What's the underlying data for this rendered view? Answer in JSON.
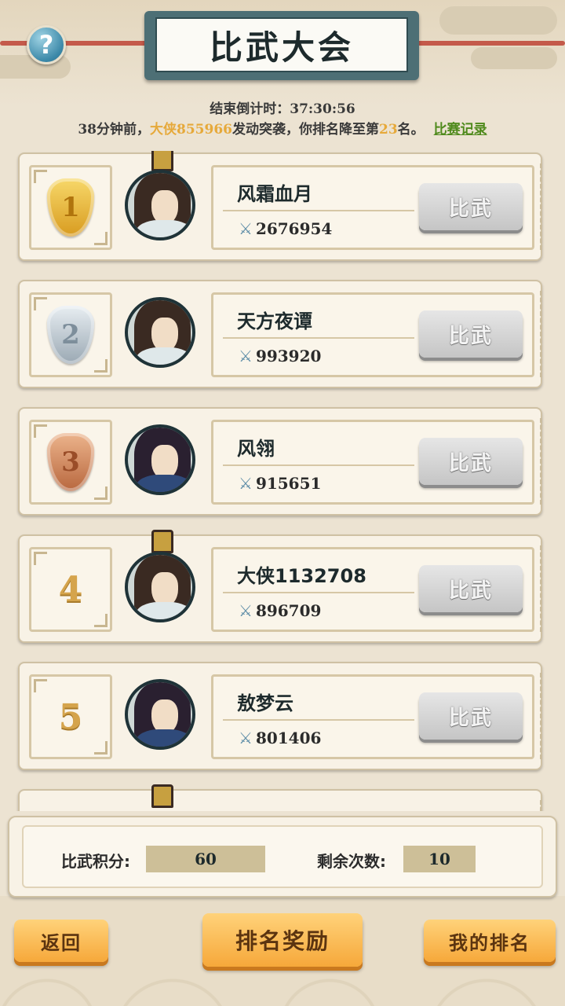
{
  "header": {
    "title": "比武大会",
    "help_label": "?",
    "countdown_label": "结束倒计时：",
    "countdown_value": "37:30:56",
    "notice": {
      "prefix": "38分钟前，",
      "attacker": "大侠855966",
      "middle": "发动突袭，你排名降至第",
      "rank": "23",
      "suffix": "名。",
      "link": "比赛记录"
    }
  },
  "players": [
    {
      "rank": "1",
      "name": "风霜血月",
      "power": "2676954",
      "button": "比武"
    },
    {
      "rank": "2",
      "name": "天方夜谭",
      "power": "993920",
      "button": "比武"
    },
    {
      "rank": "3",
      "name": "风翎",
      "power": "915651",
      "button": "比武"
    },
    {
      "rank": "4",
      "name": "大侠1132708",
      "power": "896709",
      "button": "比武"
    },
    {
      "rank": "5",
      "name": "敖梦云",
      "power": "801406",
      "button": "比武"
    }
  ],
  "stats": {
    "score_label": "比武积分:",
    "score_value": "60",
    "remaining_label": "剩余次数:",
    "remaining_value": "10"
  },
  "footer": {
    "back": "返回",
    "rewards": "排名奖励",
    "my_rank": "我的排名"
  },
  "icons": {
    "power": "crossed-swords-icon",
    "help": "question-icon"
  },
  "colors": {
    "highlight": "#e6a93a",
    "link": "#4f8a1c",
    "orange_button": "#f6a83a"
  }
}
